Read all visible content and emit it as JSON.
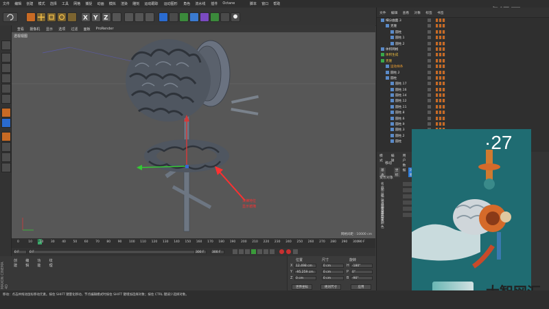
{
  "menubar": {
    "items": [
      "文件",
      "编辑",
      "创建",
      "模式",
      "选择",
      "工具",
      "网格",
      "捕捉",
      "动画",
      "模拟",
      "渲染",
      "雕刻",
      "运动跟踪",
      "运动图形",
      "角色",
      "流水线",
      "插件",
      "Octane",
      "脚本",
      "窗口",
      "帮助"
    ],
    "right_button": "无限上限"
  },
  "brand": "虎课网",
  "viewport": {
    "menu": [
      "查看",
      "摄像机",
      "显示",
      "选项",
      "过滤",
      "面板",
      "ProRender"
    ],
    "label": "透视视图",
    "grid_label": "网格间距 : 10000 cm",
    "annotation": [
      "法律地位",
      "显示遮掩"
    ]
  },
  "timeline": {
    "ticks": [
      "0",
      "10",
      "20",
      "30",
      "40",
      "50",
      "60",
      "70",
      "80",
      "90",
      "100",
      "110",
      "120",
      "130",
      "140",
      "150",
      "160",
      "170",
      "180",
      "190",
      "200",
      "210",
      "220",
      "230",
      "240",
      "250",
      "260",
      "270",
      "280",
      "290",
      "300"
    ],
    "current": "10",
    "end_frame": "90 F",
    "start_field": "0 F",
    "loop_start": "0 F",
    "loop_end": "300 F",
    "range_end": "300 F"
  },
  "material_panel": {
    "tabs": [
      "创建",
      "编辑",
      "功能",
      "纹理"
    ],
    "logo": "MAXON CINEMA 4D"
  },
  "coords": {
    "headers": [
      "位置",
      "尺寸",
      "旋转"
    ],
    "rows": [
      {
        "axis": "X",
        "pos": "12.498 cm",
        "size": "0 cm",
        "rot_label": "H",
        "rot": "-180°"
      },
      {
        "axis": "Y",
        "pos": "-95.259 cm",
        "size": "0 cm",
        "rot_label": "P",
        "rot": "0°"
      },
      {
        "axis": "Z",
        "pos": "0 cm",
        "size": "0 cm",
        "rot_label": "B",
        "rot": "-90°"
      }
    ],
    "dropdown1": "世界坐标",
    "dropdown2": "绝对尺寸",
    "apply": "应用"
  },
  "status_text": "移动：点击并拖动鼠标移动元素。按住 SHIFT 键量化移动，节点编辑模式时按住 SHIFT 键增加选择对象；按住 CTRL 键减少选择对象。",
  "object_manager": {
    "menu": [
      "文件",
      "编辑",
      "查看",
      "对象",
      "标签",
      "书签"
    ],
    "rows": [
      {
        "indent": 0,
        "name": "细分曲面.3",
        "color": "#e0e0e0"
      },
      {
        "indent": 1,
        "name": "克隆",
        "color": "#e0e0e0"
      },
      {
        "indent": 2,
        "name": "圆柱",
        "color": "#e0e0e0"
      },
      {
        "indent": 2,
        "name": "圆柱.1",
        "color": "#e0e0e0"
      },
      {
        "indent": 2,
        "name": "圆柱.2",
        "color": "#e0e0e0"
      },
      {
        "indent": 0,
        "name": "体积网格",
        "color": "#e0e0e0"
      },
      {
        "indent": 0,
        "name": "体积生成",
        "color": "#f0c040"
      },
      {
        "indent": 0,
        "name": "克隆",
        "color": "#f0c040"
      },
      {
        "indent": 1,
        "name": "运动样条",
        "color": "#f0a030"
      },
      {
        "indent": 1,
        "name": "圆柱.2",
        "color": "#e0e0e0"
      },
      {
        "indent": 1,
        "name": "圆柱",
        "color": "#e0e0e0"
      },
      {
        "indent": 2,
        "name": "圆柱.17",
        "color": "#e0e0e0"
      },
      {
        "indent": 2,
        "name": "圆柱.16",
        "color": "#e0e0e0"
      },
      {
        "indent": 2,
        "name": "圆柱.14",
        "color": "#e0e0e0"
      },
      {
        "indent": 2,
        "name": "圆柱.12",
        "color": "#e0e0e0"
      },
      {
        "indent": 2,
        "name": "圆柱.11",
        "color": "#e0e0e0"
      },
      {
        "indent": 2,
        "name": "圆柱.8",
        "color": "#e0e0e0"
      },
      {
        "indent": 2,
        "name": "圆柱.6",
        "color": "#e0e0e0"
      },
      {
        "indent": 2,
        "name": "圆柱.9",
        "color": "#e0e0e0"
      },
      {
        "indent": 2,
        "name": "圆柱.3",
        "color": "#e0e0e0"
      },
      {
        "indent": 2,
        "name": "圆柱.2",
        "color": "#e0e0e0"
      },
      {
        "indent": 2,
        "name": "圆柱",
        "color": "#e0e0e0"
      }
    ]
  },
  "attributes": {
    "menu": [
      "模式",
      "编辑",
      "用户数据"
    ],
    "tabs": [
      "基本",
      "坐标",
      "对象"
    ],
    "title": "移动",
    "section": "变形对象",
    "labels": [
      "名称",
      "图层",
      "编辑器可见",
      "渲染器可见",
      "使用颜色",
      "显示颜色"
    ]
  },
  "inset": {
    "number": "·27"
  },
  "watermark": "大智网汇",
  "colors": {
    "accent": "#2e7bd6",
    "viewport": "#575757",
    "inset_bg": "#1f6c72",
    "annotation": "#ff3030"
  }
}
